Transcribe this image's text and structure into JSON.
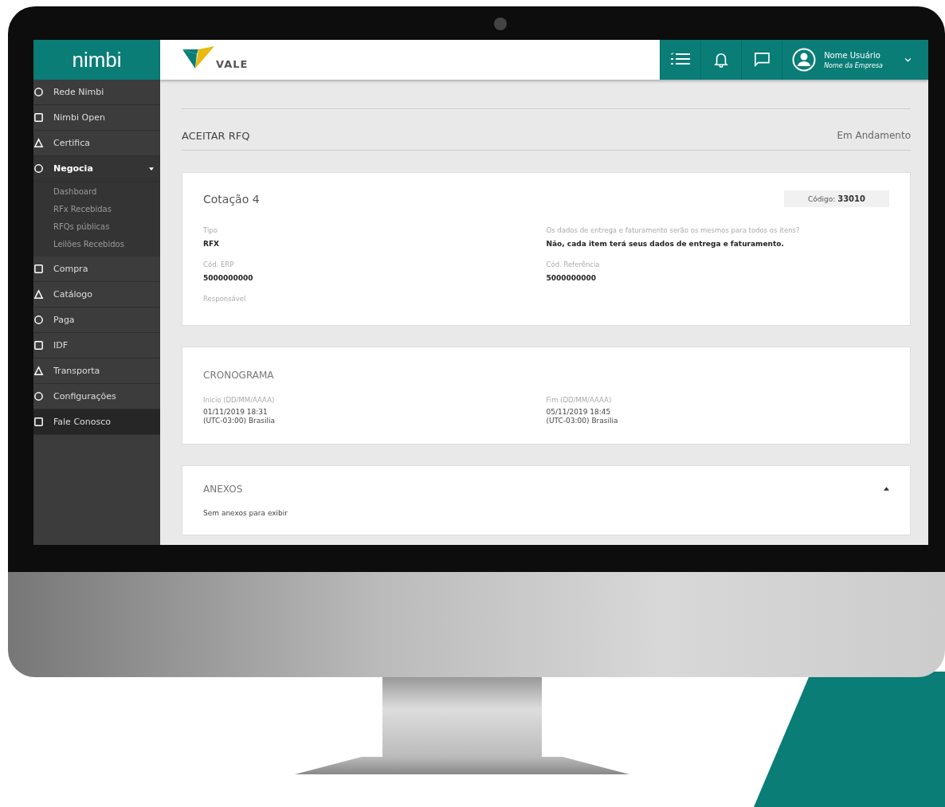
{
  "sidebar": {
    "logo": "nimbi",
    "items": [
      {
        "label": "Rede Nimbi",
        "kind": "module",
        "selected": false
      },
      {
        "label": "Nimbi Open",
        "kind": "module",
        "selected": false
      },
      {
        "label": "Certifica",
        "kind": "module",
        "selected": false
      },
      {
        "label": "Negocia",
        "kind": "module",
        "selected": true,
        "expanded": true,
        "children": [
          {
            "label": "Dashboard"
          },
          {
            "label": "RFx Recebidas"
          },
          {
            "label": "RFQs públicas"
          },
          {
            "label": "Leilões Recebidos"
          }
        ]
      },
      {
        "label": "Compra",
        "kind": "module",
        "selected": false
      },
      {
        "label": "Catálogo",
        "kind": "module",
        "selected": false
      },
      {
        "label": "Paga",
        "kind": "module",
        "selected": false
      },
      {
        "label": "IDF",
        "kind": "module",
        "selected": false
      },
      {
        "label": "Transporta",
        "kind": "module",
        "selected": false
      },
      {
        "label": "Configurações",
        "kind": "module",
        "selected": false
      },
      {
        "label": "Fale Conosco",
        "kind": "contact",
        "selected": false
      }
    ]
  },
  "topbar": {
    "brand": "VALE",
    "user_name": "Nome Usuário",
    "company": "Nome da Empresa"
  },
  "page": {
    "title": "ACEITAR RFQ",
    "status": "Em Andamento"
  },
  "quote_card": {
    "title": "Cotação 4",
    "code_label": "Código:",
    "code_value": "33010",
    "fields": [
      {
        "label": "Tipo",
        "value": "RFX"
      },
      {
        "label": "Os dados de entrega e faturamento serão os mesmos  para todos os itens?",
        "value": "Não, cada item terá seus dados de entrega e faturamento."
      },
      {
        "label": "Cód. ERP",
        "value": "5000000000"
      },
      {
        "label": "Cód. Referência",
        "value": "5000000000"
      },
      {
        "label": "Responsável"
      }
    ]
  },
  "schedule_card": {
    "title": "CRONOGRAMA",
    "fields": [
      {
        "label": "Início (DD/MM/AAAA)",
        "lines": [
          "01/11/2019 18:31",
          "(UTC-03:00) Brasilia"
        ]
      },
      {
        "label": "Fim (DD/MM/AAAA)",
        "lines": [
          "05/11/2019 18:45",
          "(UTC-03:00) Brasilia"
        ]
      }
    ]
  },
  "attachments_card": {
    "title": "ANEXOS",
    "expanded": true,
    "empty_text": "Sem anexos para exibir"
  }
}
